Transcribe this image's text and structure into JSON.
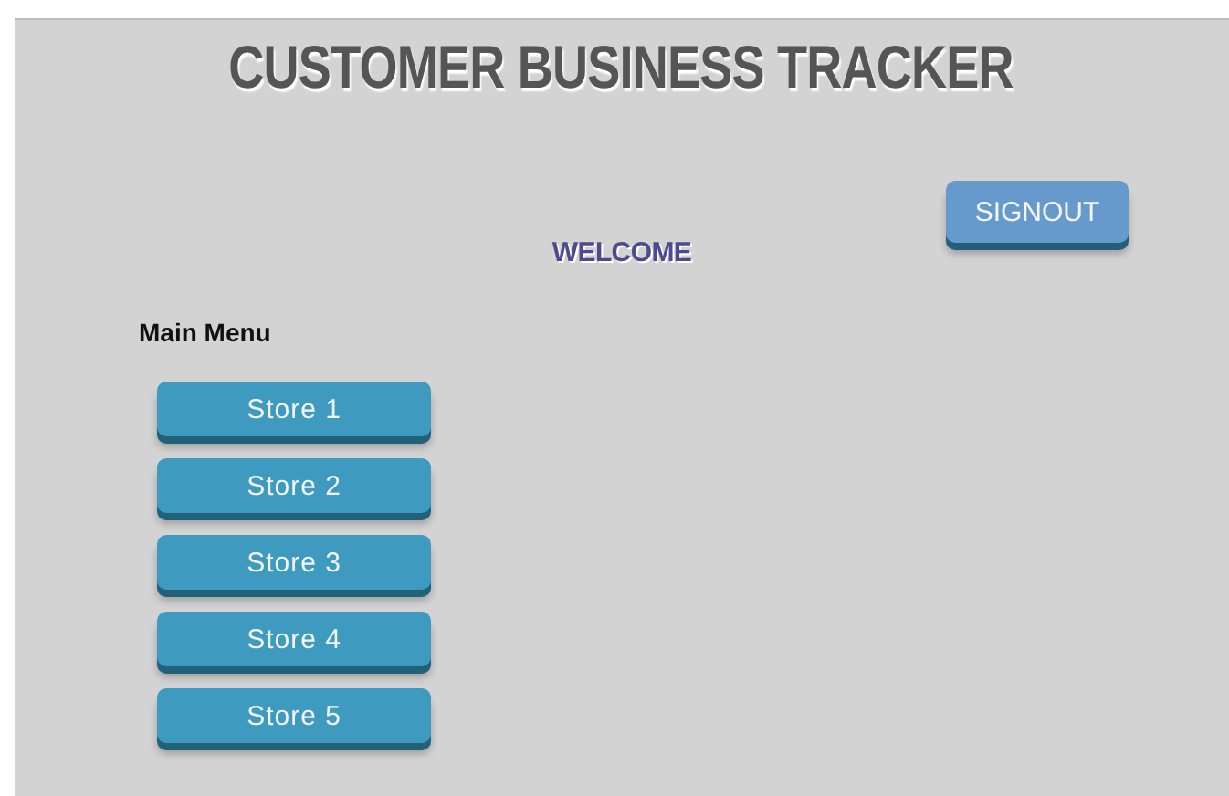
{
  "header": {
    "title": "CUSTOMER BUSINESS TRACKER"
  },
  "welcome": "WELCOME",
  "signout_button": "SIGNOUT",
  "main_menu": {
    "title": "Main Menu",
    "items": [
      {
        "label": "Store 1"
      },
      {
        "label": "Store 2"
      },
      {
        "label": "Store 3"
      },
      {
        "label": "Store 4"
      },
      {
        "label": "Store 5"
      }
    ]
  }
}
